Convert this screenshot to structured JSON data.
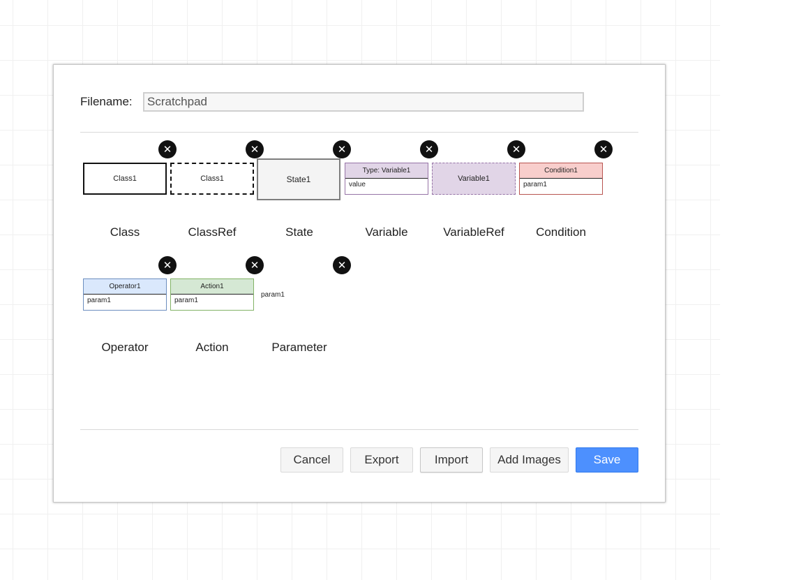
{
  "dialog": {
    "filename_label": "Filename:",
    "filename_value": "Scratchpad",
    "delete_icon": "circle-x-icon",
    "items": [
      {
        "label": "Class",
        "shape_text": "Class1"
      },
      {
        "label": "ClassRef",
        "shape_text": "Class1"
      },
      {
        "label": "State",
        "shape_text": "State1"
      },
      {
        "label": "Variable",
        "head_text": "Type: Variable1",
        "body_text": "value"
      },
      {
        "label": "VariableRef",
        "shape_text": "Variable1"
      },
      {
        "label": "Condition",
        "head_text": "Condition1",
        "body_text": "param1"
      },
      {
        "label": "Operator",
        "head_text": "Operator1",
        "body_text": "param1"
      },
      {
        "label": "Action",
        "head_text": "Action1",
        "body_text": "param1"
      },
      {
        "label": "Parameter",
        "shape_text": "param1"
      }
    ],
    "colors": {
      "variable_head": "#e1d5e7",
      "condition_head": "#f8cecc",
      "operator_head": "#dae8fc",
      "action_head": "#d5e8d4",
      "save_button": "#4d90fe"
    },
    "buttons": {
      "cancel": "Cancel",
      "export": "Export",
      "import": "Import",
      "add_images": "Add Images",
      "save": "Save"
    }
  }
}
